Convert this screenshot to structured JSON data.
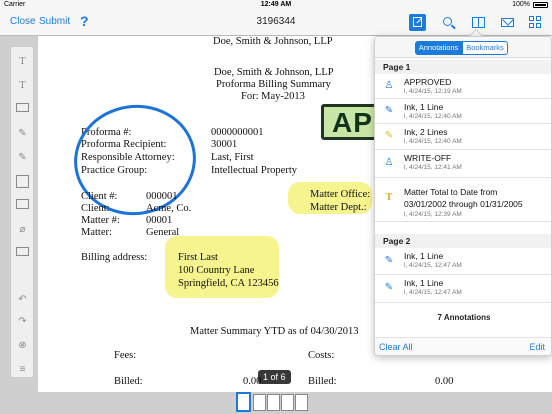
{
  "status_bar": {
    "carrier": "Carrier",
    "time": "12:49 AM",
    "battery": "100%"
  },
  "toolbar": {
    "close_label": "Close",
    "submit_label": "Submit",
    "help_label": "?",
    "title": "3196344",
    "icons": [
      "annotation-icon",
      "search-icon",
      "book-icon",
      "mail-icon",
      "grid-icon"
    ]
  },
  "document": {
    "header1": "Doe, Smith & Johnson, LLP",
    "header2": "Doe, Smith & Johnson, LLP",
    "header3": "Proforma Billing Summary",
    "header4": "For: May-2013",
    "stamp_text": "APP",
    "fields": [
      {
        "label": "Proforma #:",
        "value": "0000000001"
      },
      {
        "label": "Proforma Recipient:",
        "value": "30001"
      },
      {
        "label": "Responsible Attorney:",
        "value": "Last, First"
      },
      {
        "label": "Practice Group:",
        "value": "Intellectual Property"
      }
    ],
    "client_fields": [
      {
        "label": "Client #:",
        "value": "000001"
      },
      {
        "label": "Client:",
        "value": "Acme, Co."
      },
      {
        "label": "Matter #:",
        "value": "00001"
      },
      {
        "label": "Matter:",
        "value": "General"
      }
    ],
    "matter_office": "Matter Office:",
    "matter_dept": "Matter Dept.:",
    "billing_label": "Billing address:",
    "address": [
      "First Last",
      "100 Country Lane",
      "Springfield, CA 123456"
    ],
    "summary_title": "Matter Summary YTD as of 04/30/2013",
    "fees_label": "Fees:",
    "costs_label": "Costs:",
    "billed_label": "Billed:",
    "billed_fees_value": "0.00",
    "billed_costs_label": "Billed:",
    "billed_costs_value": "0.00",
    "page_indicator": "1 of 6"
  },
  "annotations_panel": {
    "tab_annotations": "Annotations",
    "tab_bookmarks": "Bookmarks",
    "sections": [
      {
        "title": "Page 1",
        "items": [
          {
            "icon": "stamp-icon",
            "title": "APPROVED",
            "meta": "l, 4/24/15, 12:19 AM"
          },
          {
            "icon": "ink-icon",
            "title": "Ink, 1 Line",
            "meta": "l, 4/24/15, 12:40 AM"
          },
          {
            "icon": "ink-icon",
            "title": "Ink, 2 Lines",
            "meta": "l, 4/24/15, 12:40 AM"
          },
          {
            "icon": "stamp-icon",
            "title": "WRITE-OFF",
            "meta": "l, 4/24/15, 12:41 AM"
          },
          {
            "icon": "text-icon",
            "title": "Matter Total to Date from",
            "title2": "03/01/2002 through 01/31/2005",
            "meta": "l, 4/24/15, 12:39 AM"
          }
        ]
      },
      {
        "title": "Page 2",
        "items": [
          {
            "icon": "ink-icon",
            "title": "Ink, 1 Line",
            "meta": "l, 4/24/15, 12:47 AM"
          },
          {
            "icon": "ink-icon",
            "title": "Ink, 1 Line",
            "meta": "l, 4/24/15, 12:47 AM"
          }
        ]
      }
    ],
    "count_text": "7 Annotations",
    "clear_all": "Clear All",
    "edit": "Edit"
  },
  "colors": {
    "accent": "#1a7bdc",
    "highlight": "#f5f27a",
    "ink": "#1e73d8",
    "stamp": "#c9e6a6"
  }
}
